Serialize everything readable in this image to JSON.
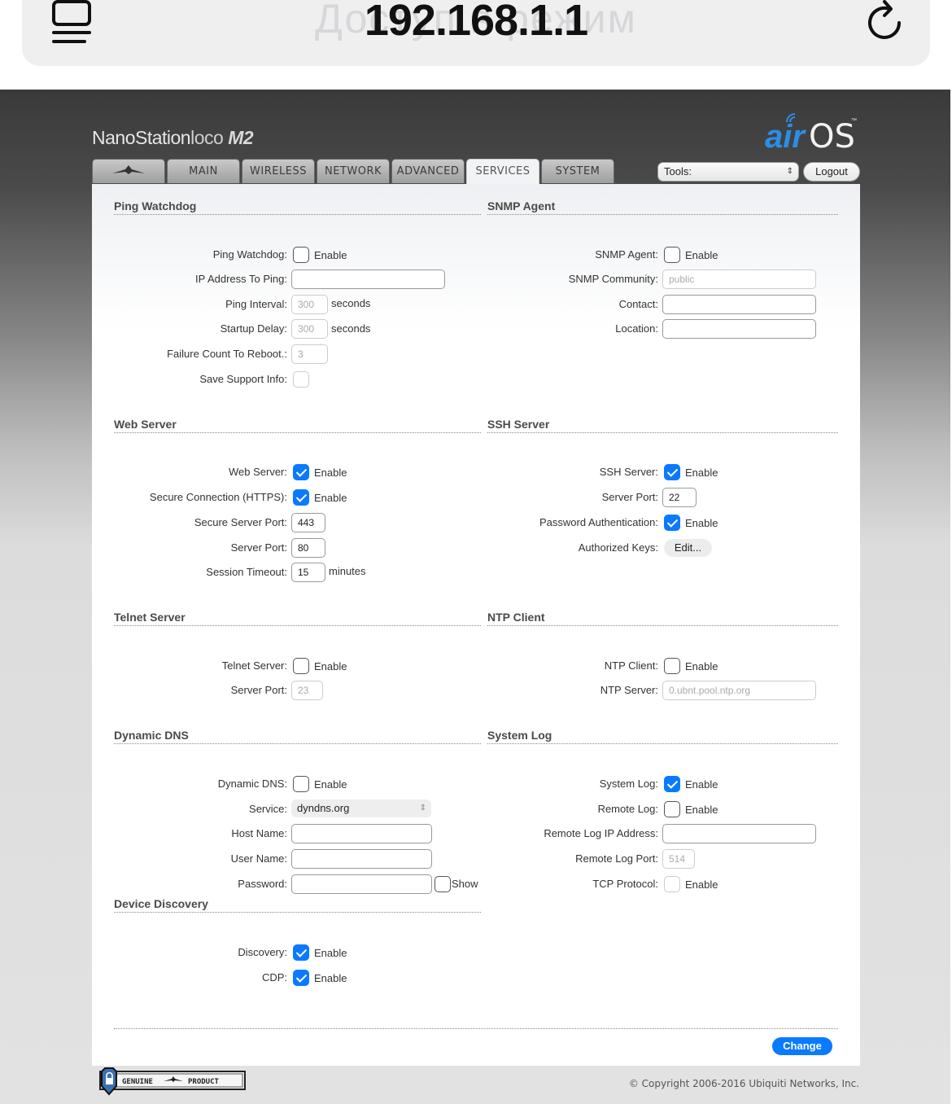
{
  "browser": {
    "url": "192.168.1.1",
    "faded_title": "Доступ в режим",
    "left_icon": "reader-icon",
    "right_icon": "reload-icon"
  },
  "header": {
    "brand_main": "NanoStation",
    "brand_loco": "loco",
    "brand_model": "M2",
    "logo": "airOS",
    "tabs": [
      "MAIN",
      "WIRELESS",
      "NETWORK",
      "ADVANCED",
      "SERVICES",
      "SYSTEM"
    ],
    "active_tab": "SERVICES",
    "tools_label": "Tools:",
    "logout_label": "Logout"
  },
  "ping_watchdog": {
    "title": "Ping Watchdog",
    "enable_label": "Ping Watchdog:",
    "enable_text": "Enable",
    "enabled": false,
    "ip_label": "IP Address To Ping:",
    "ip_value": "",
    "interval_label": "Ping Interval:",
    "interval_value": "300",
    "interval_unit": "seconds",
    "startup_label": "Startup Delay:",
    "startup_value": "300",
    "startup_unit": "seconds",
    "failure_label": "Failure Count To Reboot.:",
    "failure_value": "3",
    "support_label": "Save Support Info:",
    "support_checked": false
  },
  "snmp": {
    "title": "SNMP Agent",
    "enable_label": "SNMP Agent:",
    "enable_text": "Enable",
    "enabled": false,
    "community_label": "SNMP Community:",
    "community_placeholder": "public",
    "contact_label": "Contact:",
    "contact_value": "",
    "location_label": "Location:",
    "location_value": ""
  },
  "web_server": {
    "title": "Web Server",
    "enable_label": "Web Server:",
    "enable_text": "Enable",
    "enabled": true,
    "https_label": "Secure Connection (HTTPS):",
    "https_text": "Enable",
    "https_enabled": true,
    "secure_port_label": "Secure Server Port:",
    "secure_port_value": "443",
    "port_label": "Server Port:",
    "port_value": "80",
    "timeout_label": "Session Timeout:",
    "timeout_value": "15",
    "timeout_unit": "minutes"
  },
  "ssh_server": {
    "title": "SSH Server",
    "enable_label": "SSH Server:",
    "enable_text": "Enable",
    "enabled": true,
    "port_label": "Server Port:",
    "port_value": "22",
    "pass_auth_label": "Password Authentication:",
    "pass_auth_text": "Enable",
    "pass_auth_enabled": true,
    "keys_label": "Authorized Keys:",
    "keys_button": "Edit..."
  },
  "telnet": {
    "title": "Telnet Server",
    "enable_label": "Telnet Server:",
    "enable_text": "Enable",
    "enabled": false,
    "port_label": "Server Port:",
    "port_value": "23"
  },
  "ntp": {
    "title": "NTP Client",
    "enable_label": "NTP Client:",
    "enable_text": "Enable",
    "enabled": false,
    "server_label": "NTP Server:",
    "server_placeholder": "0.ubnt.pool.ntp.org"
  },
  "ddns": {
    "title": "Dynamic DNS",
    "enable_label": "Dynamic DNS:",
    "enable_text": "Enable",
    "enabled": false,
    "service_label": "Service:",
    "service_value": "dyndns.org",
    "host_label": "Host Name:",
    "host_value": "",
    "user_label": "User Name:",
    "user_value": "",
    "password_label": "Password:",
    "password_value": "",
    "show_label": "Show",
    "show_checked": false
  },
  "syslog": {
    "title": "System Log",
    "enable_label": "System Log:",
    "enable_text": "Enable",
    "enabled": true,
    "remote_label": "Remote Log:",
    "remote_text": "Enable",
    "remote_enabled": false,
    "remote_ip_label": "Remote Log IP Address:",
    "remote_ip_value": "",
    "remote_port_label": "Remote Log Port:",
    "remote_port_value": "514",
    "tcp_label": "TCP Protocol:",
    "tcp_text": "Enable",
    "tcp_enabled": false
  },
  "discovery": {
    "title": "Device Discovery",
    "discovery_label": "Discovery:",
    "discovery_text": "Enable",
    "discovery_enabled": true,
    "cdp_label": "CDP:",
    "cdp_text": "Enable",
    "cdp_enabled": true
  },
  "actions": {
    "change_label": "Change"
  },
  "footer": {
    "badge_left": "GENUINE",
    "badge_right": "PRODUCT",
    "copyright": "© Copyright 2006-2016 Ubiquiti Networks, Inc."
  },
  "colors": {
    "accent": "#0a7aff",
    "header_dark": "#3a3a3a"
  }
}
